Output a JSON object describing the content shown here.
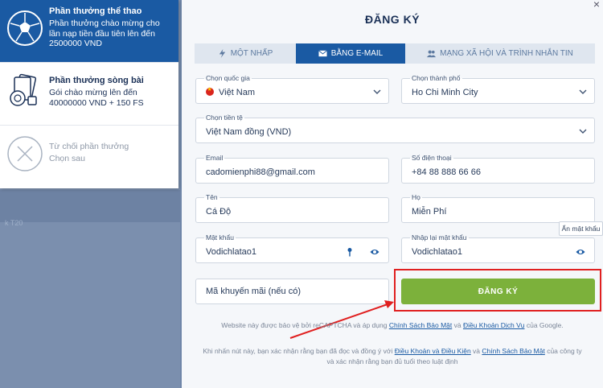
{
  "bonuses": [
    {
      "title": "Phần thưởng thể thao",
      "desc": "Phần thưởng chào mừng cho lần nạp tiền đầu tiên lên đến 2500000 VND",
      "icon": "soccer-ball-icon"
    },
    {
      "title": "Phần thưởng sòng bài",
      "desc": "Gói chào mừng lên đến 40000000 VND + 150 FS",
      "icon": "casino-cards-icon"
    },
    {
      "title": "Từ chối phần thưởng",
      "desc": "Chọn sau",
      "icon": "decline-icon"
    }
  ],
  "background": {
    "text1": "k T20"
  },
  "modal": {
    "title": "ĐĂNG KÝ",
    "close": "×",
    "tabs": [
      {
        "label": "MỘT NHẤP",
        "icon": "lightning-icon"
      },
      {
        "label": "BẰNG E-MAIL",
        "icon": "envelope-icon"
      },
      {
        "label": "MẠNG XÃ HỘI VÀ TRÌNH NHẮN TIN",
        "icon": "users-icon"
      }
    ],
    "fields": {
      "country": {
        "label": "Chọn quốc gia",
        "value": "Việt Nam"
      },
      "city": {
        "label": "Chọn thành phố",
        "value": "Ho Chi Minh City"
      },
      "currency": {
        "label": "Chọn tiền tệ",
        "value": "Việt Nam đồng (VND)"
      },
      "email": {
        "label": "Email",
        "value": "cadomienphi88@gmail.com"
      },
      "phone": {
        "label": "Số điện thoại",
        "value": "+84 88 888 66 66"
      },
      "first_name": {
        "label": "Tên",
        "value": "Cá Độ"
      },
      "last_name": {
        "label": "Họ",
        "value": "Miễn Phí"
      },
      "password": {
        "label": "Mật khẩu",
        "value": "Vodichlatao1"
      },
      "password_confirm": {
        "label": "Nhập lại mật khẩu",
        "value": "Vodichlatao1"
      }
    },
    "promo_placeholder": "Mã khuyến mãi (nếu có)",
    "submit_label": "ĐĂNG KÝ",
    "tooltip": "Ẩn mật khẩu",
    "recaptcha": {
      "pre": "Website này được bảo vệ bởi reCAPTCHA và áp dụng ",
      "link1": "Chính Sách Bảo Mật",
      "mid": " và ",
      "link2": "Điều Khoản Dịch Vụ",
      "post": " của Google."
    },
    "terms": {
      "pre": "Khi nhấn nút này, bạn xác nhận rằng bạn đã đọc và đồng ý với ",
      "link1": "Điều Khoản và Điều Kiện",
      "mid": " và ",
      "link2": "Chính Sách Bảo Mật",
      "post": " của công ty",
      "line2": "và xác nhận rằng bạn đủ tuổi theo luật định"
    }
  },
  "colors": {
    "accent": "#1a5aa3",
    "submit": "#7cb13b",
    "highlight": "#e02020"
  }
}
